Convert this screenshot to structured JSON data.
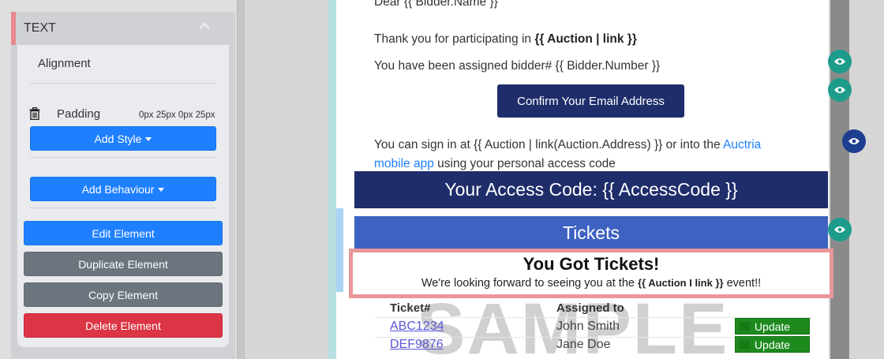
{
  "panel": {
    "section_title": "TEXT",
    "alignment_label": "Alignment",
    "padding_label": "Padding",
    "padding_value": "0px 25px 0px 25px",
    "add_style_label": "Add Style",
    "add_behaviour_label": "Add Behaviour",
    "edit_label": "Edit Element",
    "duplicate_label": "Duplicate Element",
    "copy_label": "Copy Element",
    "delete_label": "Delete Element"
  },
  "colors": {
    "primary_blue": "#1f80ff",
    "secondary_gray": "#6c757d",
    "danger_red": "#dc3545",
    "email_navy": "#1f2d6b",
    "tickets_blue": "#3d62c1",
    "selection_pink": "#e8979b",
    "update_green": "#1e8a1e",
    "eye_teal": "#1d9c8c",
    "eye_navy": "#1e3f8f"
  },
  "email": {
    "greeting": "Dear {{ Bidder.Name }}",
    "thank_you_prefix": "Thank you for participating in ",
    "thank_you_bold": "{{ Auction | link }}",
    "assigned_line": "You have been assigned bidder# {{ Bidder.Number }}",
    "confirm_button": "Confirm Your Email Address",
    "signin_prefix": "You can sign in at {{ Auction | link(Auction.Address) }} or into the ",
    "signin_link_1": "Auctria",
    "signin_link_2": "mobile app",
    "signin_suffix": " using your personal access code",
    "access_code_banner": "Your Access Code: {{ AccessCode }}",
    "tickets_banner": "Tickets",
    "got_tickets_title": "You Got Tickets!",
    "got_tickets_prefix": "We're looking forward to seeing you at the ",
    "got_tickets_bold": "{{ Auction I link }}",
    "got_tickets_suffix": " event!!",
    "watermark": "SAMPLE",
    "table": {
      "col_ticket": "Ticket#",
      "col_assigned": "Assigned to",
      "rows": [
        {
          "ticket": "ABC1234",
          "assigned": "John Smith",
          "action": "Update"
        },
        {
          "ticket": "DEF9876",
          "assigned": "Jane Doe",
          "action": "Update"
        }
      ]
    }
  },
  "icons": {
    "collapse": "chevron-up-icon",
    "trash": "trash-icon",
    "visibility": "eye-icon"
  }
}
